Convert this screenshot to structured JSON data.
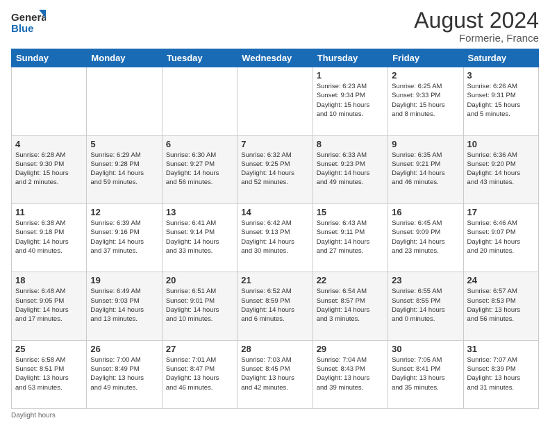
{
  "header": {
    "logo_general": "General",
    "logo_blue": "Blue",
    "month_year": "August 2024",
    "location": "Formerie, France"
  },
  "days_of_week": [
    "Sunday",
    "Monday",
    "Tuesday",
    "Wednesday",
    "Thursday",
    "Friday",
    "Saturday"
  ],
  "weeks": [
    [
      {
        "day": "",
        "info": ""
      },
      {
        "day": "",
        "info": ""
      },
      {
        "day": "",
        "info": ""
      },
      {
        "day": "",
        "info": ""
      },
      {
        "day": "1",
        "info": "Sunrise: 6:23 AM\nSunset: 9:34 PM\nDaylight: 15 hours\nand 10 minutes."
      },
      {
        "day": "2",
        "info": "Sunrise: 6:25 AM\nSunset: 9:33 PM\nDaylight: 15 hours\nand 8 minutes."
      },
      {
        "day": "3",
        "info": "Sunrise: 6:26 AM\nSunset: 9:31 PM\nDaylight: 15 hours\nand 5 minutes."
      }
    ],
    [
      {
        "day": "4",
        "info": "Sunrise: 6:28 AM\nSunset: 9:30 PM\nDaylight: 15 hours\nand 2 minutes."
      },
      {
        "day": "5",
        "info": "Sunrise: 6:29 AM\nSunset: 9:28 PM\nDaylight: 14 hours\nand 59 minutes."
      },
      {
        "day": "6",
        "info": "Sunrise: 6:30 AM\nSunset: 9:27 PM\nDaylight: 14 hours\nand 56 minutes."
      },
      {
        "day": "7",
        "info": "Sunrise: 6:32 AM\nSunset: 9:25 PM\nDaylight: 14 hours\nand 52 minutes."
      },
      {
        "day": "8",
        "info": "Sunrise: 6:33 AM\nSunset: 9:23 PM\nDaylight: 14 hours\nand 49 minutes."
      },
      {
        "day": "9",
        "info": "Sunrise: 6:35 AM\nSunset: 9:21 PM\nDaylight: 14 hours\nand 46 minutes."
      },
      {
        "day": "10",
        "info": "Sunrise: 6:36 AM\nSunset: 9:20 PM\nDaylight: 14 hours\nand 43 minutes."
      }
    ],
    [
      {
        "day": "11",
        "info": "Sunrise: 6:38 AM\nSunset: 9:18 PM\nDaylight: 14 hours\nand 40 minutes."
      },
      {
        "day": "12",
        "info": "Sunrise: 6:39 AM\nSunset: 9:16 PM\nDaylight: 14 hours\nand 37 minutes."
      },
      {
        "day": "13",
        "info": "Sunrise: 6:41 AM\nSunset: 9:14 PM\nDaylight: 14 hours\nand 33 minutes."
      },
      {
        "day": "14",
        "info": "Sunrise: 6:42 AM\nSunset: 9:13 PM\nDaylight: 14 hours\nand 30 minutes."
      },
      {
        "day": "15",
        "info": "Sunrise: 6:43 AM\nSunset: 9:11 PM\nDaylight: 14 hours\nand 27 minutes."
      },
      {
        "day": "16",
        "info": "Sunrise: 6:45 AM\nSunset: 9:09 PM\nDaylight: 14 hours\nand 23 minutes."
      },
      {
        "day": "17",
        "info": "Sunrise: 6:46 AM\nSunset: 9:07 PM\nDaylight: 14 hours\nand 20 minutes."
      }
    ],
    [
      {
        "day": "18",
        "info": "Sunrise: 6:48 AM\nSunset: 9:05 PM\nDaylight: 14 hours\nand 17 minutes."
      },
      {
        "day": "19",
        "info": "Sunrise: 6:49 AM\nSunset: 9:03 PM\nDaylight: 14 hours\nand 13 minutes."
      },
      {
        "day": "20",
        "info": "Sunrise: 6:51 AM\nSunset: 9:01 PM\nDaylight: 14 hours\nand 10 minutes."
      },
      {
        "day": "21",
        "info": "Sunrise: 6:52 AM\nSunset: 8:59 PM\nDaylight: 14 hours\nand 6 minutes."
      },
      {
        "day": "22",
        "info": "Sunrise: 6:54 AM\nSunset: 8:57 PM\nDaylight: 14 hours\nand 3 minutes."
      },
      {
        "day": "23",
        "info": "Sunrise: 6:55 AM\nSunset: 8:55 PM\nDaylight: 14 hours\nand 0 minutes."
      },
      {
        "day": "24",
        "info": "Sunrise: 6:57 AM\nSunset: 8:53 PM\nDaylight: 13 hours\nand 56 minutes."
      }
    ],
    [
      {
        "day": "25",
        "info": "Sunrise: 6:58 AM\nSunset: 8:51 PM\nDaylight: 13 hours\nand 53 minutes."
      },
      {
        "day": "26",
        "info": "Sunrise: 7:00 AM\nSunset: 8:49 PM\nDaylight: 13 hours\nand 49 minutes."
      },
      {
        "day": "27",
        "info": "Sunrise: 7:01 AM\nSunset: 8:47 PM\nDaylight: 13 hours\nand 46 minutes."
      },
      {
        "day": "28",
        "info": "Sunrise: 7:03 AM\nSunset: 8:45 PM\nDaylight: 13 hours\nand 42 minutes."
      },
      {
        "day": "29",
        "info": "Sunrise: 7:04 AM\nSunset: 8:43 PM\nDaylight: 13 hours\nand 39 minutes."
      },
      {
        "day": "30",
        "info": "Sunrise: 7:05 AM\nSunset: 8:41 PM\nDaylight: 13 hours\nand 35 minutes."
      },
      {
        "day": "31",
        "info": "Sunrise: 7:07 AM\nSunset: 8:39 PM\nDaylight: 13 hours\nand 31 minutes."
      }
    ]
  ],
  "footer": {
    "note": "Daylight hours"
  }
}
